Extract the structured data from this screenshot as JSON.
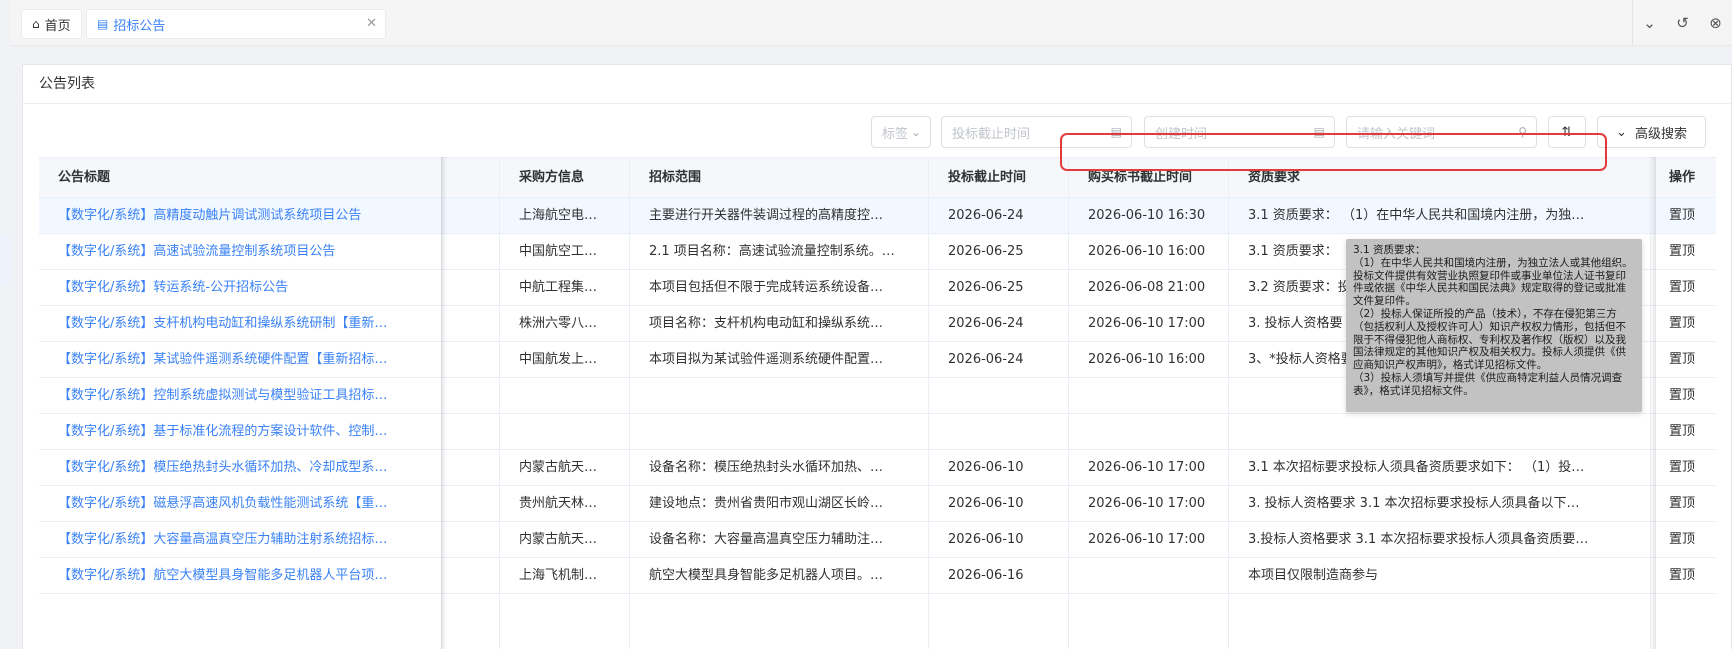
{
  "tabs": {
    "home_label": "首页",
    "active_label": "招标公告"
  },
  "panel": {
    "title": "公告列表"
  },
  "toolbar": {
    "tag_label": "标签",
    "deadline_placeholder": "投标截止时间",
    "created_placeholder": "创建时间",
    "search_placeholder": "请输入关键词",
    "advanced_label": "高级搜索"
  },
  "table": {
    "headers": {
      "title": "公告标题",
      "buyer": "采购方信息",
      "scope": "招标范围",
      "bid_deadline": "投标截止时间",
      "doc_deadline": "购买标书截止时间",
      "qualification": "资质要求",
      "action": "操作"
    },
    "rows": [
      {
        "title": "【数字化/系统】高精度动触片调试测试系统项目公告",
        "buyer": "上海航空电…",
        "scope": "主要进行开关器件装调过程的高精度控…",
        "bid_deadline": "2026-06-24",
        "doc_deadline": "2026-06-10 16:30",
        "qualification": "3.1 资质要求： （1）在中华人民共和国境内注册，为独…",
        "action": "置顶"
      },
      {
        "title": "【数字化/系统】高速试验流量控制系统项目公告",
        "buyer": "中国航空工…",
        "scope": "2.1 项目名称：高速试验流量控制系统。…",
        "bid_deadline": "2026-06-25",
        "doc_deadline": "2026-06-10 16:00",
        "qualification": "3.1 资质要求：",
        "action": "置顶"
      },
      {
        "title": "【数字化/系统】转运系统-公开招标公告",
        "buyer": "中航工程集…",
        "scope": "本项目包括但不限于完成转运系统设备…",
        "bid_deadline": "2026-06-25",
        "doc_deadline": "2026-06-08 21:00",
        "qualification": "3.2 资质要求：投",
        "action": "置顶"
      },
      {
        "title": "【数字化/系统】支杆机构电动缸和操纵系统研制【重新…",
        "buyer": "株洲六零八…",
        "scope": "项目名称：支杆机构电动缸和操纵系统…",
        "bid_deadline": "2026-06-24",
        "doc_deadline": "2026-06-10 17:00",
        "qualification": "3.  投标人资格要",
        "action": "置顶"
      },
      {
        "title": "【数字化/系统】某试验件遥测系统硬件配置【重新招标…",
        "buyer": "中国航发上…",
        "scope": "本项目拟为某试验件遥测系统硬件配置…",
        "bid_deadline": "2026-06-24",
        "doc_deadline": "2026-06-10 16:00",
        "qualification": "3、*投标人资格要",
        "action": "置顶"
      },
      {
        "title": "【数字化/系统】控制系统虚拟测试与模型验证工具招标…",
        "buyer": "",
        "scope": "",
        "bid_deadline": "",
        "doc_deadline": "",
        "qualification": "",
        "action": "置顶"
      },
      {
        "title": "【数字化/系统】基于标准化流程的方案设计软件、控制…",
        "buyer": "",
        "scope": "",
        "bid_deadline": "",
        "doc_deadline": "",
        "qualification": "",
        "action": "置顶"
      },
      {
        "title": "【数字化/系统】模压绝热封头水循环加热、冷却成型系…",
        "buyer": "内蒙古航天…",
        "scope": "设备名称：模压绝热封头水循环加热、…",
        "bid_deadline": "2026-06-10",
        "doc_deadline": "2026-06-10 17:00",
        "qualification": "3.1 本次招标要求投标人须具备资质要求如下： （1）投…",
        "action": "置顶"
      },
      {
        "title": "【数字化/系统】磁悬浮高速风机负载性能测试系统【重…",
        "buyer": "贵州航天林…",
        "scope": "建设地点：贵州省贵阳市观山湖区长岭…",
        "bid_deadline": "2026-06-10",
        "doc_deadline": "2026-06-10 17:00",
        "qualification": "3. 投标人资格要求 3.1 本次招标要求投标人须具备以下…",
        "action": "置顶"
      },
      {
        "title": "【数字化/系统】大容量高温真空压力辅助注射系统招标…",
        "buyer": "内蒙古航天…",
        "scope": "设备名称：大容量高温真空压力辅助注…",
        "bid_deadline": "2026-06-10",
        "doc_deadline": "2026-06-10 17:00",
        "qualification": "3.投标人资格要求 3.1 本次招标要求投标人须具备资质要…",
        "action": "置顶"
      },
      {
        "title": "【数字化/系统】航空大模型具身智能多足机器人平台项…",
        "buyer": "上海飞机制…",
        "scope": "航空大模型具身智能多足机器人项目。…",
        "bid_deadline": "2026-06-16",
        "doc_deadline": "",
        "qualification": "本项目仅限制造商参与",
        "action": "置顶"
      }
    ]
  },
  "tooltip": {
    "line1": "3.1 资质要求：",
    "line2": "（1）在中华人民共和国境内注册，为独立法人或其他组织。投标文件提供有效营业执照复印件或事业单位法人证书复印件或依据《中华人民共和国民法典》规定取得的登记或批准文件复印件。",
    "line3": "（2）投标人保证所投的产品（技术），不存在侵犯第三方（包括权利人及授权许可人）知识产权权力情形，包括但不限于不得侵犯他人商标权、专利权及著作权（版权）以及我国法律规定的其他知识产权及相关权力。投标人须提供《供应商知识产权声明》，格式详见招标文件。",
    "line4": "（3）投标人须填写并提供《供应商特定利益人员情况调查表》，格式详见招标文件。"
  }
}
